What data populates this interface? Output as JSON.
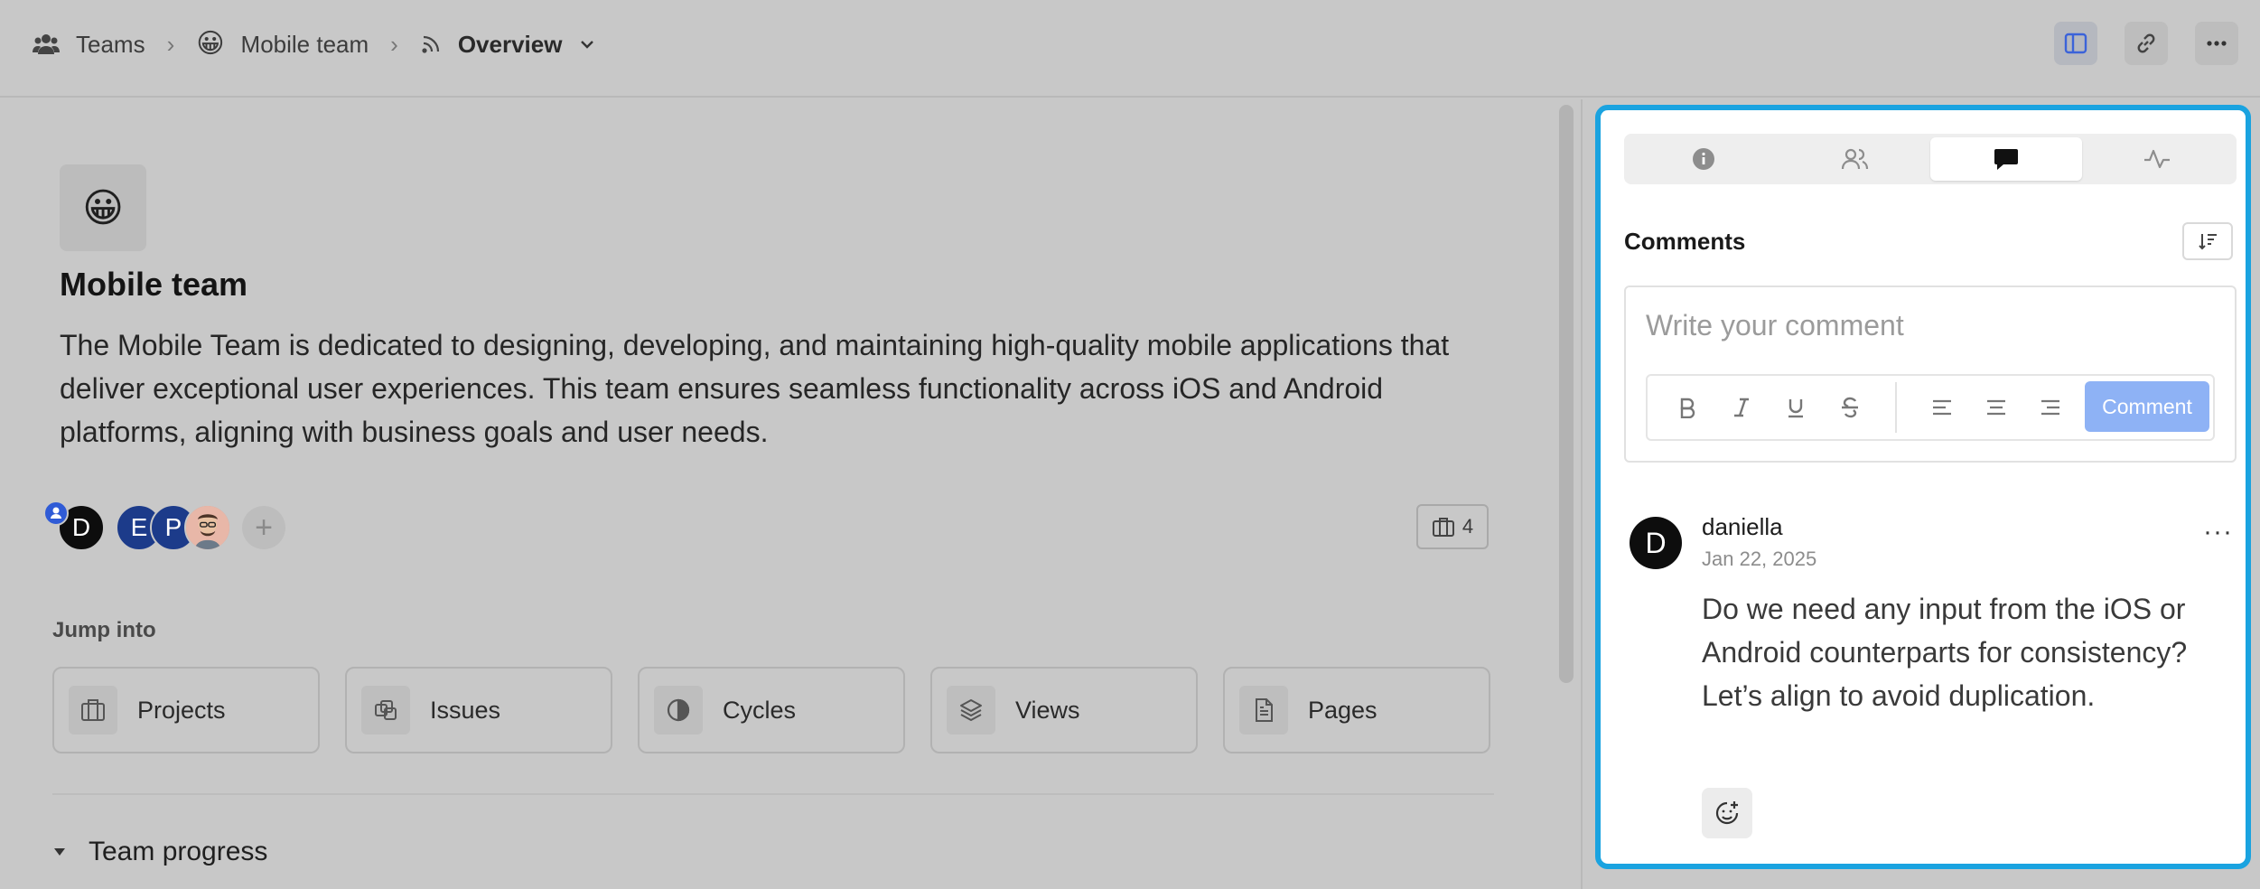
{
  "breadcrumb": {
    "teams": "Teams",
    "team": "Mobile team",
    "team_emoji": "😀",
    "view": "Overview"
  },
  "team": {
    "emoji": "😀",
    "name": "Mobile team",
    "description": "The Mobile Team is dedicated to designing, developing, and maintaining high-quality mobile applications that deliver exceptional user experiences. This team ensures seamless functionality across iOS and Android platforms, aligning with business goals and user needs.",
    "members": [
      {
        "initial": "D"
      },
      {
        "initial": "E"
      },
      {
        "initial": "P"
      }
    ],
    "add_member": "+",
    "project_count": "4"
  },
  "jump_into": {
    "label": "Jump into",
    "items": [
      {
        "label": "Projects",
        "icon": "briefcase-icon"
      },
      {
        "label": "Issues",
        "icon": "layers-icon"
      },
      {
        "label": "Cycles",
        "icon": "contrast-icon"
      },
      {
        "label": "Views",
        "icon": "stack-icon"
      },
      {
        "label": "Pages",
        "icon": "document-icon"
      }
    ]
  },
  "progress": {
    "label": "Team progress"
  },
  "sidebar": {
    "tabs": [
      "info-icon",
      "users-icon",
      "comment-icon",
      "activity-icon"
    ],
    "active_tab": 2,
    "comments_title": "Comments",
    "editor_placeholder": "Write your comment",
    "comment_button": "Comment",
    "comment": {
      "author_initial": "D",
      "author": "daniella",
      "date": "Jan 22, 2025",
      "more": "···",
      "text": "Do we need any input from the iOS or Android counterparts for consistency? Let’s align to avoid duplication."
    }
  },
  "colors": {
    "accent_border": "#1aa3e0",
    "comment_button": "#8eb2f5",
    "avatar_blue": "#1c3b8a"
  }
}
